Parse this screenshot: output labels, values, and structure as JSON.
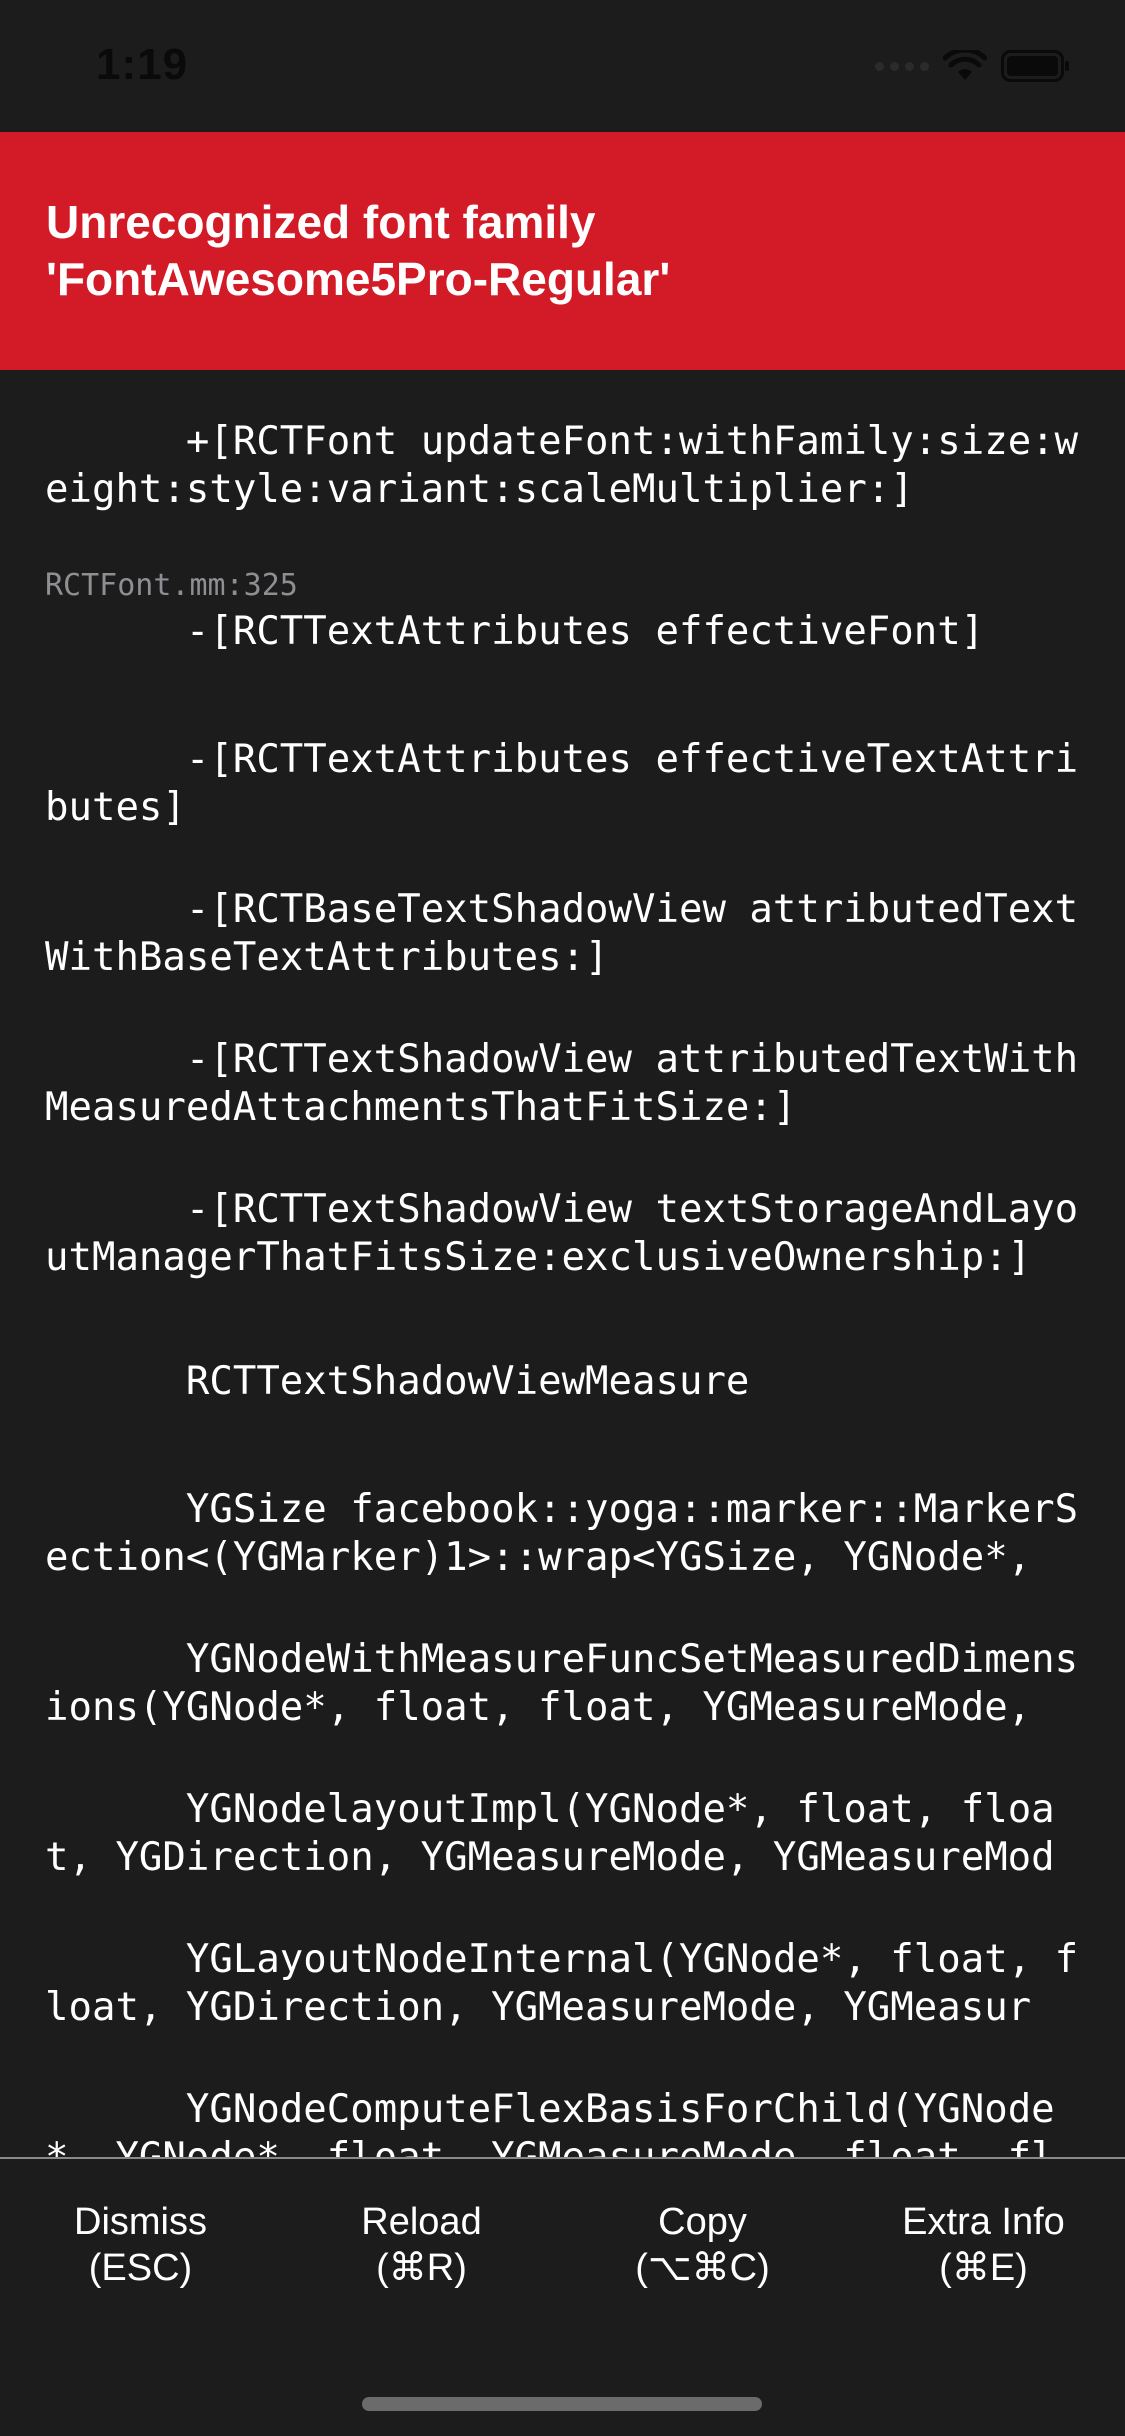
{
  "status_bar": {
    "time": "1:19"
  },
  "error": {
    "title": "Unrecognized font family\n'FontAwesome5Pro-Regular'",
    "header_color": "#d31b27"
  },
  "stack": [
    {
      "method": "+[RCTFont updateFont:withFamily:size:weight:style:variant:scaleMultiplier:]",
      "file": "RCTFont.mm:325"
    },
    {
      "method": "-[RCTTextAttributes effectiveFont]",
      "file": ""
    },
    {
      "method": "-[RCTTextAttributes effectiveTextAttributes]",
      "file": ""
    },
    {
      "method": "-[RCTBaseTextShadowView attributedTextWithBaseTextAttributes:]",
      "file": ""
    },
    {
      "method": "-[RCTTextShadowView attributedTextWithMeasuredAttachmentsThatFitSize:]",
      "file": ""
    },
    {
      "method": "-[RCTTextShadowView textStorageAndLayoutManagerThatFitsSize:exclusiveOwnership:]",
      "file": ""
    },
    {
      "method": "RCTTextShadowViewMeasure",
      "file": ""
    },
    {
      "method": "YGSize facebook::yoga::marker::MarkerSection<(YGMarker)1>::wrap<YGSize, YGNode*,",
      "file": ""
    },
    {
      "method": "YGNodeWithMeasureFuncSetMeasuredDimensions(YGNode*, float, float, YGMeasureMode,",
      "file": ""
    },
    {
      "method": "YGNodelayoutImpl(YGNode*, float, float, YGDirection, YGMeasureMode, YGMeasureMod",
      "file": ""
    },
    {
      "method": "YGLayoutNodeInternal(YGNode*, float, float, YGDirection, YGMeasureMode, YGMeasur",
      "file": ""
    },
    {
      "method": "YGNodeComputeFlexBasisForChild(YGNode*, YGNode*, float, YGMeasureMode, float, fl",
      "file": ""
    }
  ],
  "toolbar": {
    "buttons": [
      {
        "label": "Dismiss",
        "key": "(ESC)"
      },
      {
        "label": "Reload",
        "key": "(⌘R)"
      },
      {
        "label": "Copy",
        "key": "(⌥⌘C)"
      },
      {
        "label": "Extra Info",
        "key": "(⌘E)"
      }
    ]
  },
  "icons": {
    "signal": "cellular-signal-icon",
    "wifi": "wifi-icon",
    "battery": "battery-icon"
  }
}
